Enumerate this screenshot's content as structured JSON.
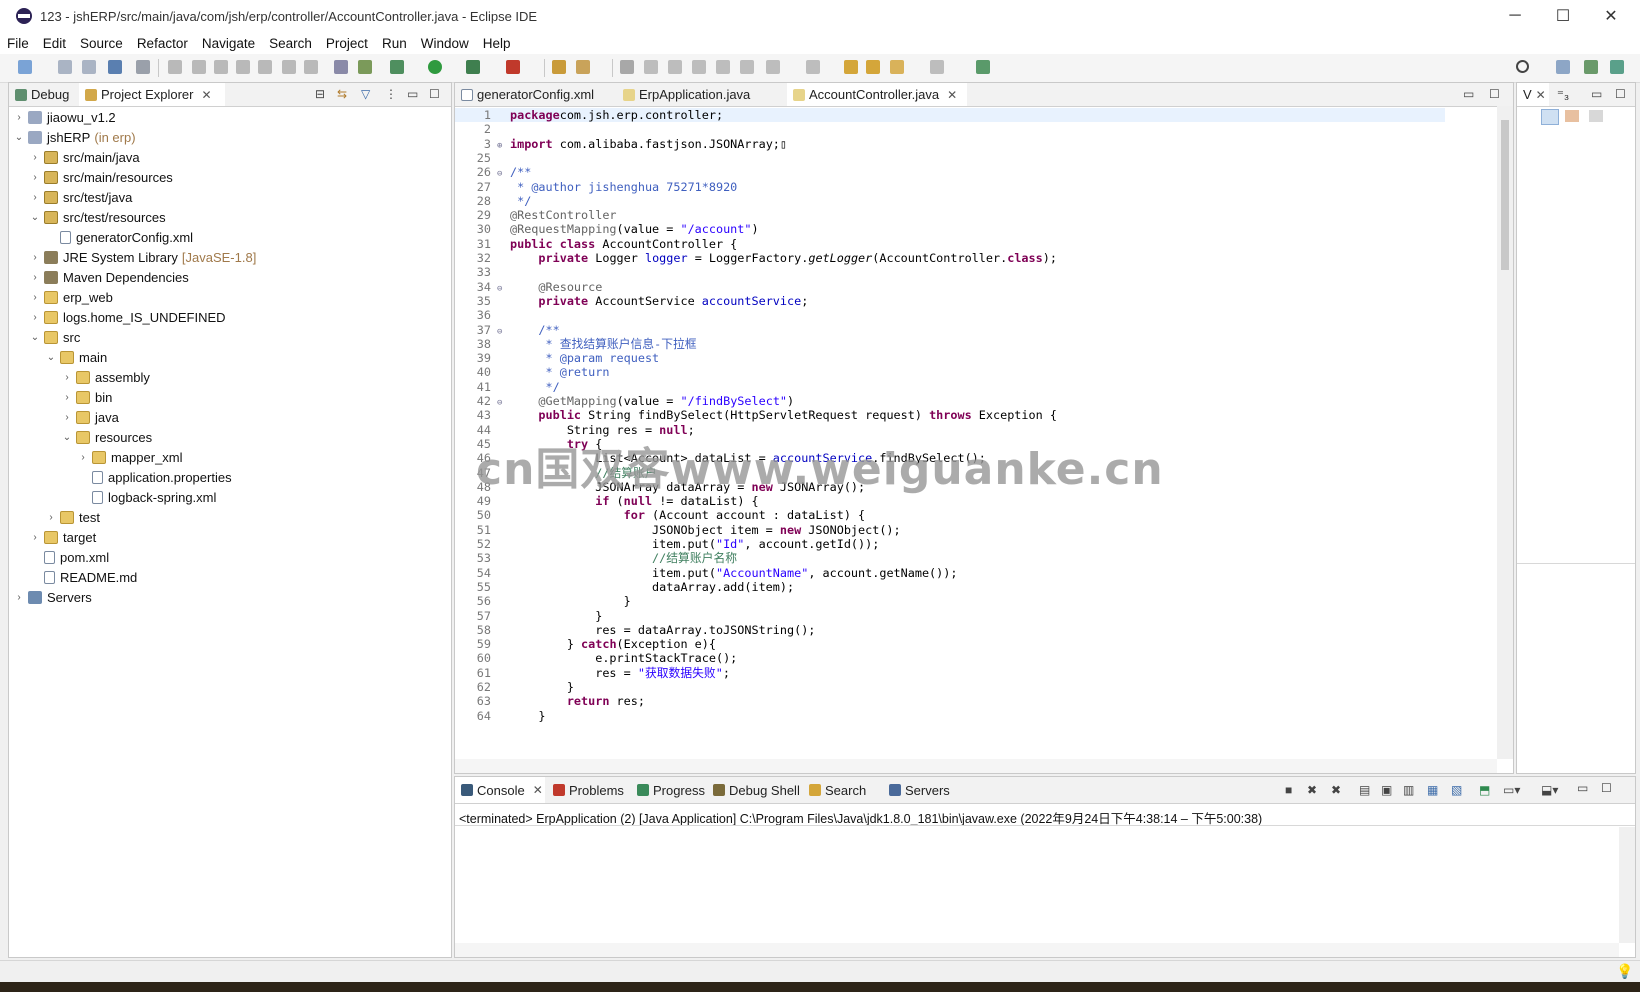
{
  "window": {
    "title": "123 - jshERP/src/main/java/com/jsh/erp/controller/AccountController.java - Eclipse IDE",
    "minimize": "─",
    "maximize": "☐",
    "close": "✕"
  },
  "menu": [
    "File",
    "Edit",
    "Source",
    "Refactor",
    "Navigate",
    "Search",
    "Project",
    "Run",
    "Window",
    "Help"
  ],
  "left_panel": {
    "tabs": [
      "Debug",
      "Project Explorer"
    ]
  },
  "tree": [
    {
      "label": "jiaowu_v1.2",
      "deco": "",
      "indent": 0,
      "tw": ">",
      "icon": "proj"
    },
    {
      "label": "jshERP",
      "deco": "(in erp)",
      "indent": 0,
      "tw": "v",
      "icon": "proj"
    },
    {
      "label": "src/main/java",
      "deco": "",
      "indent": 1,
      "tw": ">",
      "icon": "pkg"
    },
    {
      "label": "src/main/resources",
      "deco": "",
      "indent": 1,
      "tw": ">",
      "icon": "pkg"
    },
    {
      "label": "src/test/java",
      "deco": "",
      "indent": 1,
      "tw": ">",
      "icon": "pkg"
    },
    {
      "label": "src/test/resources",
      "deco": "",
      "indent": 1,
      "tw": "v",
      "icon": "pkg"
    },
    {
      "label": "generatorConfig.xml",
      "deco": "",
      "indent": 2,
      "tw": "",
      "icon": "file"
    },
    {
      "label": "JRE System Library",
      "deco": "[JavaSE-1.8]",
      "indent": 1,
      "tw": ">",
      "icon": "lib"
    },
    {
      "label": "Maven Dependencies",
      "deco": "",
      "indent": 1,
      "tw": ">",
      "icon": "lib"
    },
    {
      "label": "erp_web",
      "deco": "",
      "indent": 1,
      "tw": ">",
      "icon": "folder"
    },
    {
      "label": "logs.home_IS_UNDEFINED",
      "deco": "",
      "indent": 1,
      "tw": ">",
      "icon": "folder"
    },
    {
      "label": "src",
      "deco": "",
      "indent": 1,
      "tw": "v",
      "icon": "folder"
    },
    {
      "label": "main",
      "deco": "",
      "indent": 2,
      "tw": "v",
      "icon": "folder"
    },
    {
      "label": "assembly",
      "deco": "",
      "indent": 3,
      "tw": ">",
      "icon": "folder"
    },
    {
      "label": "bin",
      "deco": "",
      "indent": 3,
      "tw": ">",
      "icon": "folder"
    },
    {
      "label": "java",
      "deco": "",
      "indent": 3,
      "tw": ">",
      "icon": "folder"
    },
    {
      "label": "resources",
      "deco": "",
      "indent": 3,
      "tw": "v",
      "icon": "folder"
    },
    {
      "label": "mapper_xml",
      "deco": "",
      "indent": 4,
      "tw": ">",
      "icon": "folder"
    },
    {
      "label": "application.properties",
      "deco": "",
      "indent": 4,
      "tw": "",
      "icon": "file"
    },
    {
      "label": "logback-spring.xml",
      "deco": "",
      "indent": 4,
      "tw": "",
      "icon": "file"
    },
    {
      "label": "test",
      "deco": "",
      "indent": 2,
      "tw": ">",
      "icon": "folder"
    },
    {
      "label": "target",
      "deco": "",
      "indent": 1,
      "tw": ">",
      "icon": "folder"
    },
    {
      "label": "pom.xml",
      "deco": "",
      "indent": 1,
      "tw": "",
      "icon": "file"
    },
    {
      "label": "README.md",
      "deco": "",
      "indent": 1,
      "tw": "",
      "icon": "file"
    },
    {
      "label": "Servers",
      "deco": "",
      "indent": 0,
      "tw": ">",
      "icon": "srv"
    }
  ],
  "editor": {
    "tabs": [
      "generatorConfig.xml",
      "ErpApplication.java",
      "AccountController.java"
    ]
  },
  "code": [
    {
      "n": "1",
      "f": "",
      "t": [
        [
          "kw",
          "package"
        ],
        [
          "",
          "com.jsh.erp.controller;"
        ]
      ]
    },
    {
      "n": "2",
      "f": "",
      "t": []
    },
    {
      "n": "3",
      "f": "⊕",
      "t": [
        [
          "kw",
          "import"
        ],
        [
          "",
          " com.alibaba.fastjson.JSONArray;"
        ],
        [
          "",
          "▯"
        ]
      ]
    },
    {
      "n": "25",
      "f": "",
      "t": []
    },
    {
      "n": "26",
      "f": "⊖",
      "t": [
        [
          "jd",
          "/**"
        ]
      ]
    },
    {
      "n": "27",
      "f": "",
      "t": [
        [
          "jd",
          " * "
        ],
        [
          "jd",
          "@author"
        ],
        [
          "jd",
          " jishenghua 75271*8920"
        ]
      ]
    },
    {
      "n": "28",
      "f": "",
      "t": [
        [
          "jd",
          " */"
        ]
      ]
    },
    {
      "n": "29",
      "f": "",
      "t": [
        [
          "ann",
          "@RestController"
        ]
      ]
    },
    {
      "n": "30",
      "f": "",
      "t": [
        [
          "ann",
          "@RequestMapping"
        ],
        [
          "",
          "(value = "
        ],
        [
          "str",
          "\"/account\""
        ],
        [
          "",
          ")"
        ]
      ]
    },
    {
      "n": "31",
      "f": "",
      "t": [
        [
          "kw",
          "public class"
        ],
        [
          "",
          " AccountController {"
        ]
      ]
    },
    {
      "n": "32",
      "f": "",
      "t": [
        [
          "",
          "    "
        ],
        [
          "kw",
          "private"
        ],
        [
          "",
          " Logger "
        ],
        [
          "fld",
          "logger"
        ],
        [
          "",
          " = LoggerFactory."
        ],
        [
          "it",
          "getLogger"
        ],
        [
          "",
          "(AccountController."
        ],
        [
          "kw",
          "class"
        ],
        [
          "",
          ");"
        ]
      ]
    },
    {
      "n": "33",
      "f": "",
      "t": []
    },
    {
      "n": "34",
      "f": "⊖",
      "t": [
        [
          "",
          "    "
        ],
        [
          "ann",
          "@Resource"
        ]
      ]
    },
    {
      "n": "35",
      "f": "",
      "t": [
        [
          "",
          "    "
        ],
        [
          "kw",
          "private"
        ],
        [
          "",
          " AccountService "
        ],
        [
          "fld",
          "accountService"
        ],
        [
          "",
          ";"
        ]
      ]
    },
    {
      "n": "36",
      "f": "",
      "t": []
    },
    {
      "n": "37",
      "f": "⊖",
      "t": [
        [
          "",
          "    "
        ],
        [
          "jd",
          "/**"
        ]
      ]
    },
    {
      "n": "38",
      "f": "",
      "t": [
        [
          "jd",
          "     * 查找结算账户信息-下拉框"
        ]
      ]
    },
    {
      "n": "39",
      "f": "",
      "t": [
        [
          "jd",
          "     * @param request"
        ]
      ]
    },
    {
      "n": "40",
      "f": "",
      "t": [
        [
          "jd",
          "     * @return"
        ]
      ]
    },
    {
      "n": "41",
      "f": "",
      "t": [
        [
          "jd",
          "     */"
        ]
      ]
    },
    {
      "n": "42",
      "f": "⊖",
      "t": [
        [
          "",
          "    "
        ],
        [
          "ann",
          "@GetMapping"
        ],
        [
          "",
          "(value = "
        ],
        [
          "str",
          "\"/findBySelect\""
        ],
        [
          "",
          ")"
        ]
      ]
    },
    {
      "n": "43",
      "f": "",
      "t": [
        [
          "",
          "    "
        ],
        [
          "kw",
          "public"
        ],
        [
          "",
          " String findBySelect(HttpServletRequest request) "
        ],
        [
          "kw",
          "throws"
        ],
        [
          "",
          " Exception {"
        ]
      ]
    },
    {
      "n": "44",
      "f": "",
      "t": [
        [
          "",
          "        String res = "
        ],
        [
          "kw",
          "null"
        ],
        [
          "",
          ";"
        ]
      ]
    },
    {
      "n": "45",
      "f": "",
      "t": [
        [
          "",
          "        "
        ],
        [
          "kw",
          "try"
        ],
        [
          "",
          " {"
        ]
      ]
    },
    {
      "n": "46",
      "f": "",
      "t": [
        [
          "",
          "            List<Account> dataList = "
        ],
        [
          "fld",
          "accountService"
        ],
        [
          "",
          ".findBySelect();"
        ]
      ]
    },
    {
      "n": "47",
      "f": "",
      "t": [
        [
          "",
          "            "
        ],
        [
          "cm",
          "//结算账户"
        ]
      ]
    },
    {
      "n": "48",
      "f": "",
      "t": [
        [
          "",
          "            JSONArray dataArray = "
        ],
        [
          "kw",
          "new"
        ],
        [
          "",
          " JSONArray();"
        ]
      ]
    },
    {
      "n": "49",
      "f": "",
      "t": [
        [
          "",
          "            "
        ],
        [
          "kw",
          "if"
        ],
        [
          "",
          " ("
        ],
        [
          "kw",
          "null"
        ],
        [
          "",
          " != dataList) {"
        ]
      ]
    },
    {
      "n": "50",
      "f": "",
      "t": [
        [
          "",
          "                "
        ],
        [
          "kw",
          "for"
        ],
        [
          "",
          " (Account account : dataList) {"
        ]
      ]
    },
    {
      "n": "51",
      "f": "",
      "t": [
        [
          "",
          "                    JSONObject item = "
        ],
        [
          "kw",
          "new"
        ],
        [
          "",
          " JSONObject();"
        ]
      ]
    },
    {
      "n": "52",
      "f": "",
      "t": [
        [
          "",
          "                    item.put("
        ],
        [
          "str",
          "\"Id\""
        ],
        [
          "",
          ", account.getId());"
        ]
      ]
    },
    {
      "n": "53",
      "f": "",
      "t": [
        [
          "",
          "                    "
        ],
        [
          "cm",
          "//结算账户名称"
        ]
      ]
    },
    {
      "n": "54",
      "f": "",
      "t": [
        [
          "",
          "                    item.put("
        ],
        [
          "str",
          "\"AccountName\""
        ],
        [
          "",
          ", account.getName());"
        ]
      ]
    },
    {
      "n": "55",
      "f": "",
      "t": [
        [
          "",
          "                    dataArray.add(item);"
        ]
      ]
    },
    {
      "n": "56",
      "f": "",
      "t": [
        [
          "",
          "                }"
        ]
      ]
    },
    {
      "n": "57",
      "f": "",
      "t": [
        [
          "",
          "            }"
        ]
      ]
    },
    {
      "n": "58",
      "f": "",
      "t": [
        [
          "",
          "            res = dataArray.toJSONString();"
        ]
      ]
    },
    {
      "n": "59",
      "f": "",
      "t": [
        [
          "",
          "        } "
        ],
        [
          "kw",
          "catch"
        ],
        [
          "",
          "(Exception e){"
        ]
      ]
    },
    {
      "n": "60",
      "f": "",
      "t": [
        [
          "",
          "            e.printStackTrace();"
        ]
      ]
    },
    {
      "n": "61",
      "f": "",
      "t": [
        [
          "",
          "            res = "
        ],
        [
          "str",
          "\"获取数据失败\""
        ],
        [
          "",
          ";"
        ]
      ]
    },
    {
      "n": "62",
      "f": "",
      "t": [
        [
          "",
          "        }"
        ]
      ]
    },
    {
      "n": "63",
      "f": "",
      "t": [
        [
          "",
          "        "
        ],
        [
          "kw",
          "return"
        ],
        [
          "",
          " res;"
        ]
      ]
    },
    {
      "n": "64",
      "f": "",
      "t": [
        [
          "",
          "    }"
        ]
      ]
    }
  ],
  "right_panel": {
    "tab": "V",
    "tab2": "⁼₃"
  },
  "console": {
    "tabs": [
      "Console",
      "Problems",
      "Progress",
      "Debug Shell",
      "Search",
      "Servers"
    ],
    "line": "<terminated> ErpApplication (2) [Java Application] C:\\Program Files\\Java\\jdk1.8.0_181\\bin\\javaw.exe  (2022年9月24日下午4:38:14 – 下午5:00:38)"
  },
  "watermark": "cn国双客www.weiguanke.cn",
  "colors": {
    "keyword": "#7f0055",
    "string": "#2a00ff",
    "comment": "#3f7f5f",
    "javadoc": "#3f5fbf",
    "field": "#0000c0",
    "annotation": "#646464"
  }
}
